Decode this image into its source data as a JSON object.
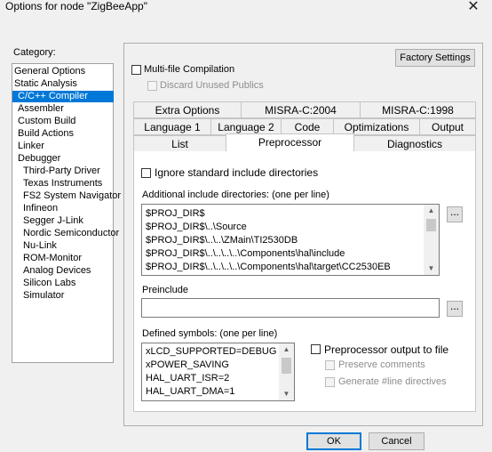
{
  "window": {
    "title": "Options for node \"ZigBeeApp\"",
    "close_glyph": "✕"
  },
  "category": {
    "label": "Category:",
    "items": [
      "General Options",
      "Static Analysis",
      "C/C++ Compiler",
      "Assembler",
      "Custom Build",
      "Build Actions",
      "Linker",
      "Debugger",
      "Third-Party Driver",
      "Texas Instruments",
      "FS2 System Navigator",
      "Infineon",
      "Segger J-Link",
      "Nordic Semiconductor",
      "Nu-Link",
      "ROM-Monitor",
      "Analog Devices",
      "Silicon Labs",
      "Simulator"
    ],
    "selected": "C/C++ Compiler"
  },
  "panel": {
    "factory_settings": "Factory Settings",
    "multi_file": "Multi-file Compilation",
    "discard_unused": "Discard Unused Publics"
  },
  "tabs": {
    "row1": [
      "Extra Options",
      "MISRA-C:2004",
      "MISRA-C:1998"
    ],
    "row2": [
      "Language 1",
      "Language 2",
      "Code",
      "Optimizations",
      "Output"
    ],
    "row3": [
      "List",
      "Preprocessor",
      "Diagnostics"
    ],
    "active": "Preprocessor"
  },
  "preprocessor": {
    "ignore_std": "Ignore standard include directories",
    "additional_label": "Additional include directories: (one per line)",
    "include_dirs": [
      "$PROJ_DIR$",
      "$PROJ_DIR$\\..\\Source",
      "$PROJ_DIR$\\..\\..\\ZMain\\TI2530DB",
      "$PROJ_DIR$\\..\\..\\..\\..\\Components\\hal\\include",
      "$PROJ_DIR$\\..\\..\\..\\..\\Components\\hal\\target\\CC2530EB"
    ],
    "browse_glyph": "...",
    "preinclude_label": "Preinclude",
    "preinclude_value": "",
    "defined_label": "Defined symbols: (one per line)",
    "defined_symbols": [
      "xLCD_SUPPORTED=DEBUG",
      "xPOWER_SAVING",
      "HAL_UART_ISR=2",
      "HAL_UART_DMA=1"
    ],
    "pp_output": "Preprocessor output to file",
    "preserve_comments": "Preserve comments",
    "generate_line": "Generate #line directives"
  },
  "footer": {
    "ok": "OK",
    "cancel": "Cancel"
  },
  "icons": {
    "scroll_up": "▲",
    "scroll_down": "▼"
  }
}
